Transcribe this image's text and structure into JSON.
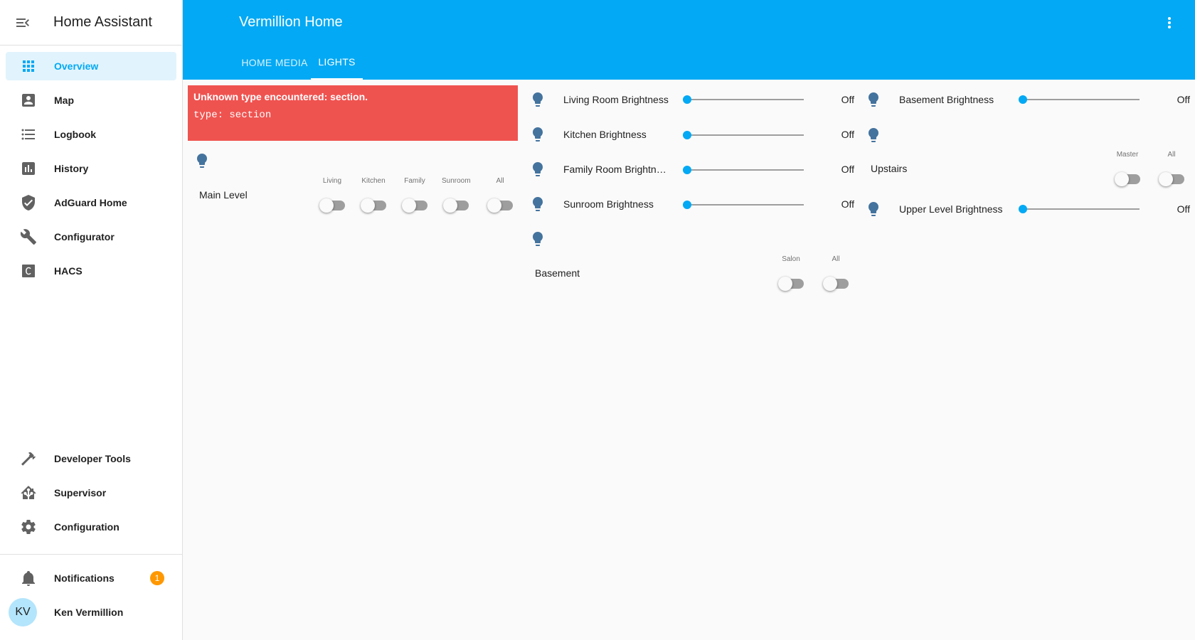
{
  "sidebar": {
    "title": "Home Assistant",
    "items": [
      {
        "label": "Overview",
        "icon": "view-dashboard-icon",
        "active": true
      },
      {
        "label": "Map",
        "icon": "account-box-icon"
      },
      {
        "label": "Logbook",
        "icon": "format-list-bulleted-icon"
      },
      {
        "label": "History",
        "icon": "chart-box-icon"
      },
      {
        "label": "AdGuard Home",
        "icon": "shield-check-icon"
      },
      {
        "label": "Configurator",
        "icon": "wrench-icon"
      },
      {
        "label": "HACS",
        "icon": "hacs-icon"
      }
    ],
    "bottom_items": [
      {
        "label": "Developer Tools",
        "icon": "hammer-icon"
      },
      {
        "label": "Supervisor",
        "icon": "home-assistant-icon"
      },
      {
        "label": "Configuration",
        "icon": "cog-icon"
      }
    ],
    "notifications": {
      "label": "Notifications",
      "count": "1"
    },
    "user": {
      "initials": "KV",
      "name": "Ken Vermillion"
    }
  },
  "header": {
    "title": "Vermillion Home",
    "tabs": [
      {
        "label": "HOME MEDIA",
        "active": false
      },
      {
        "label": "LIGHTS",
        "active": true
      }
    ]
  },
  "error_card": {
    "title": "Unknown type encountered: section.",
    "code": "type: section"
  },
  "main_level": {
    "name": "Main Level",
    "switches": [
      {
        "label": "Living",
        "on": false
      },
      {
        "label": "Kitchen",
        "on": false
      },
      {
        "label": "Family",
        "on": false
      },
      {
        "label": "Sunroom",
        "on": false
      },
      {
        "label": "All",
        "on": false
      }
    ]
  },
  "middle_column": {
    "rows": [
      {
        "label": "Living Room Brightness",
        "state": "Off",
        "level": 0
      },
      {
        "label": "Kitchen Brightness",
        "state": "Off",
        "level": 0
      },
      {
        "label": "Family Room Brightne...",
        "state": "Off",
        "level": 0
      },
      {
        "label": "Sunroom Brightness",
        "state": "Off",
        "level": 0
      }
    ],
    "basement": {
      "name": "Basement",
      "switches": [
        {
          "label": "Salon",
          "on": false
        },
        {
          "label": "All",
          "on": false
        }
      ]
    }
  },
  "right_column": {
    "basement_brightness": {
      "label": "Basement Brightness",
      "state": "Off",
      "level": 0
    },
    "upstairs": {
      "name": "Upstairs",
      "switches": [
        {
          "label": "Master",
          "on": false
        },
        {
          "label": "All",
          "on": false
        }
      ]
    },
    "upper_level_brightness": {
      "label": "Upper Level Brightness",
      "state": "Off",
      "level": 0
    }
  },
  "colors": {
    "primary": "#03a9f4",
    "bulb": "#44739e",
    "error": "#ef5350",
    "badge": "#ff9800"
  }
}
